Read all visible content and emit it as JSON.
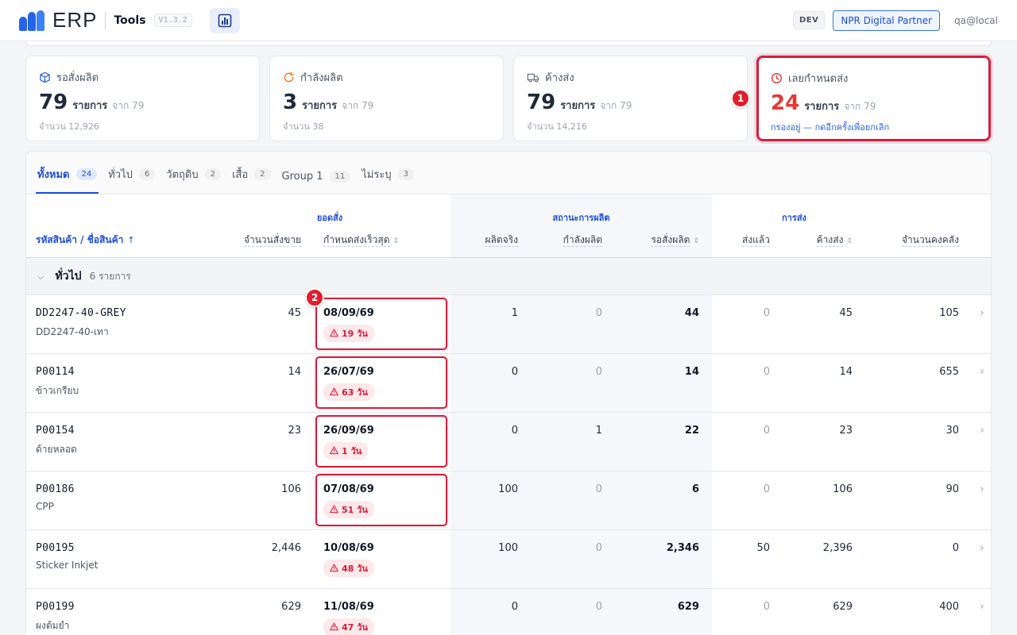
{
  "header": {
    "logo_text": "ERP",
    "app_name": "Tools",
    "version": "V1.3.2",
    "env": "DEV",
    "partner": "NPR Digital Partner",
    "user": "qa@local"
  },
  "colors": {
    "accent": "#1d4ed8",
    "danger": "#d81b3a",
    "warning": "#f97316"
  },
  "stats": [
    {
      "label": "รอสั่งผลิต",
      "icon": "cube-icon",
      "value": "79",
      "unit": "รายการ",
      "from": "จาก 79",
      "foot": "จำนวน 12,926"
    },
    {
      "label": "กำลังผลิต",
      "icon": "refresh-icon",
      "value": "3",
      "unit": "รายการ",
      "from": "จาก 79",
      "foot": "จำนวน 38"
    },
    {
      "label": "ค้างส่ง",
      "icon": "truck-icon",
      "value": "79",
      "unit": "รายการ",
      "from": "จาก 79",
      "foot": "จำนวน 14,216"
    },
    {
      "label": "เลยกำหนดส่ง",
      "icon": "clock-icon",
      "value": "24",
      "unit": "รายการ",
      "from": "จาก 79",
      "foot": "กรองอยู่ — กดอีกครั้งเพื่อยกเลิก"
    }
  ],
  "markers": [
    "1",
    "2"
  ],
  "tabs": [
    {
      "label": "ทั้งหมด",
      "count": "24"
    },
    {
      "label": "ทั่วไป",
      "count": "6"
    },
    {
      "label": "วัตถุดิบ",
      "count": "2"
    },
    {
      "label": "เสื้อ",
      "count": "2"
    },
    {
      "label": "Group 1",
      "count": "11"
    },
    {
      "label": "ไม่ระบุ",
      "count": "3"
    }
  ],
  "table": {
    "groups": {
      "orders": "ยอดสั่ง",
      "production": "สถานะการผลิต",
      "shipping": "การส่ง"
    },
    "columns": {
      "product": "รหัสสินค้า / ชื่อสินค้า",
      "order_qty": "จำนวนสั่งขาย",
      "due": "กำหนดส่งเร็วสุด",
      "produced": "ผลิตจริง",
      "in_progress": "กำลังผลิต",
      "pending": "รอสั่งผลิต",
      "shipped": "ส่งแล้ว",
      "backlog": "ค้างส่ง",
      "stock": "จำนวนคงคลัง"
    },
    "section": {
      "title": "ทั่วไป",
      "count": "6 รายการ"
    },
    "rows": [
      {
        "code": "DD2247-40-GREY",
        "name": "DD2247-40-เทา",
        "order_qty": "45",
        "due": "08/09/69",
        "late": "19 วัน",
        "produced": "1",
        "in_progress": "0",
        "pending": "44",
        "shipped": "0",
        "backlog": "45",
        "stock": "105"
      },
      {
        "code": "P00114",
        "name": "ข้าวเกรียบ",
        "order_qty": "14",
        "due": "26/07/69",
        "late": "63 วัน",
        "produced": "0",
        "in_progress": "0",
        "pending": "14",
        "shipped": "0",
        "backlog": "14",
        "stock": "655"
      },
      {
        "code": "P00154",
        "name": "ด้ายหลอด",
        "order_qty": "23",
        "due": "26/09/69",
        "late": "1 วัน",
        "produced": "0",
        "in_progress": "1",
        "pending": "22",
        "shipped": "0",
        "backlog": "23",
        "stock": "30"
      },
      {
        "code": "P00186",
        "name": "CPP",
        "order_qty": "106",
        "due": "07/08/69",
        "late": "51 วัน",
        "produced": "100",
        "in_progress": "0",
        "pending": "6",
        "shipped": "0",
        "backlog": "106",
        "stock": "90"
      },
      {
        "code": "P00195",
        "name": "Sticker Inkjet",
        "order_qty": "2,446",
        "due": "10/08/69",
        "late": "48 วัน",
        "produced": "100",
        "in_progress": "0",
        "pending": "2,346",
        "shipped": "50",
        "backlog": "2,396",
        "stock": "0"
      },
      {
        "code": "P00199",
        "name": "ผงต้มยำ",
        "order_qty": "629",
        "due": "11/08/69",
        "late": "47 วัน",
        "produced": "0",
        "in_progress": "0",
        "pending": "629",
        "shipped": "0",
        "backlog": "629",
        "stock": "400"
      }
    ]
  }
}
